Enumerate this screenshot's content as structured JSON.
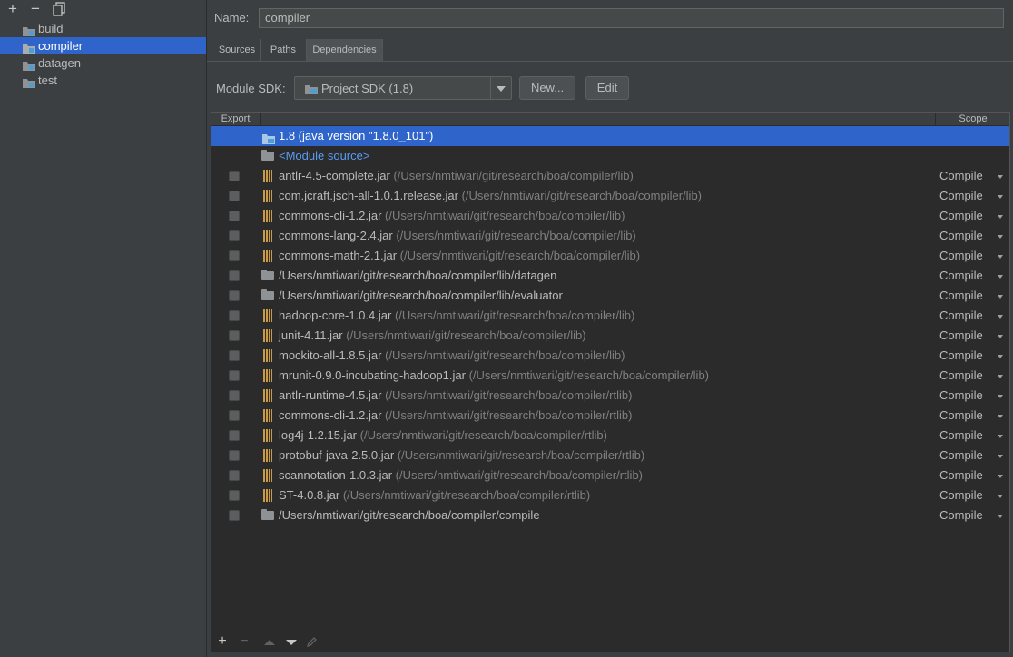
{
  "left_toolbar": {
    "add": "+",
    "remove": "−"
  },
  "tree": [
    {
      "label": "build"
    },
    {
      "label": "compiler",
      "selected": true
    },
    {
      "label": "datagen"
    },
    {
      "label": "test"
    }
  ],
  "name_label": "Name:",
  "name_value": "compiler",
  "tabs": [
    {
      "label": "Sources"
    },
    {
      "label": "Paths"
    },
    {
      "label": "Dependencies",
      "active": true
    }
  ],
  "sdk": {
    "label": "Module SDK:",
    "value": "Project SDK (1.8)",
    "new_button": "New...",
    "edit_button": "Edit"
  },
  "table": {
    "col_export": "Export",
    "col_scope": "Scope",
    "sdk_row": "1.8 (java version \"1.8.0_101\")",
    "module_source": "<Module source>",
    "rows": [
      {
        "name": "antlr-4.5-complete.jar",
        "path": "(/Users/nmtiwari/git/research/boa/compiler/lib)",
        "icon": "jar",
        "scope": "Compile"
      },
      {
        "name": "com.jcraft.jsch-all-1.0.1.release.jar",
        "path": "(/Users/nmtiwari/git/research/boa/compiler/lib)",
        "icon": "jar",
        "scope": "Compile"
      },
      {
        "name": "commons-cli-1.2.jar",
        "path": "(/Users/nmtiwari/git/research/boa/compiler/lib)",
        "icon": "jar",
        "scope": "Compile"
      },
      {
        "name": "commons-lang-2.4.jar",
        "path": "(/Users/nmtiwari/git/research/boa/compiler/lib)",
        "icon": "jar",
        "scope": "Compile"
      },
      {
        "name": "commons-math-2.1.jar",
        "path": "(/Users/nmtiwari/git/research/boa/compiler/lib)",
        "icon": "jar",
        "scope": "Compile"
      },
      {
        "name": "/Users/nmtiwari/git/research/boa/compiler/lib/datagen",
        "path": "",
        "icon": "folder",
        "scope": "Compile"
      },
      {
        "name": "/Users/nmtiwari/git/research/boa/compiler/lib/evaluator",
        "path": "",
        "icon": "folder",
        "scope": "Compile"
      },
      {
        "name": "hadoop-core-1.0.4.jar",
        "path": "(/Users/nmtiwari/git/research/boa/compiler/lib)",
        "icon": "jar",
        "scope": "Compile"
      },
      {
        "name": "junit-4.11.jar",
        "path": "(/Users/nmtiwari/git/research/boa/compiler/lib)",
        "icon": "jar",
        "scope": "Compile"
      },
      {
        "name": "mockito-all-1.8.5.jar",
        "path": "(/Users/nmtiwari/git/research/boa/compiler/lib)",
        "icon": "jar",
        "scope": "Compile"
      },
      {
        "name": "mrunit-0.9.0-incubating-hadoop1.jar",
        "path": "(/Users/nmtiwari/git/research/boa/compiler/lib)",
        "icon": "jar",
        "scope": "Compile"
      },
      {
        "name": "antlr-runtime-4.5.jar",
        "path": "(/Users/nmtiwari/git/research/boa/compiler/rtlib)",
        "icon": "jar",
        "scope": "Compile"
      },
      {
        "name": "commons-cli-1.2.jar",
        "path": "(/Users/nmtiwari/git/research/boa/compiler/rtlib)",
        "icon": "jar",
        "scope": "Compile"
      },
      {
        "name": "log4j-1.2.15.jar",
        "path": "(/Users/nmtiwari/git/research/boa/compiler/rtlib)",
        "icon": "jar",
        "scope": "Compile"
      },
      {
        "name": "protobuf-java-2.5.0.jar",
        "path": "(/Users/nmtiwari/git/research/boa/compiler/rtlib)",
        "icon": "jar",
        "scope": "Compile"
      },
      {
        "name": "scannotation-1.0.3.jar",
        "path": "(/Users/nmtiwari/git/research/boa/compiler/rtlib)",
        "icon": "jar",
        "scope": "Compile"
      },
      {
        "name": "ST-4.0.8.jar",
        "path": "(/Users/nmtiwari/git/research/boa/compiler/rtlib)",
        "icon": "jar",
        "scope": "Compile"
      },
      {
        "name": "/Users/nmtiwari/git/research/boa/compiler/compile",
        "path": "",
        "icon": "folder",
        "scope": "Compile"
      }
    ]
  },
  "bottom_toolbar": {
    "add": "+",
    "remove": "−"
  },
  "colors": {
    "background": "#3c3f41",
    "table_bg": "#2b2b2b",
    "selection": "#2f65ca",
    "module_source": "#589df6",
    "jar": "#c99b48"
  }
}
